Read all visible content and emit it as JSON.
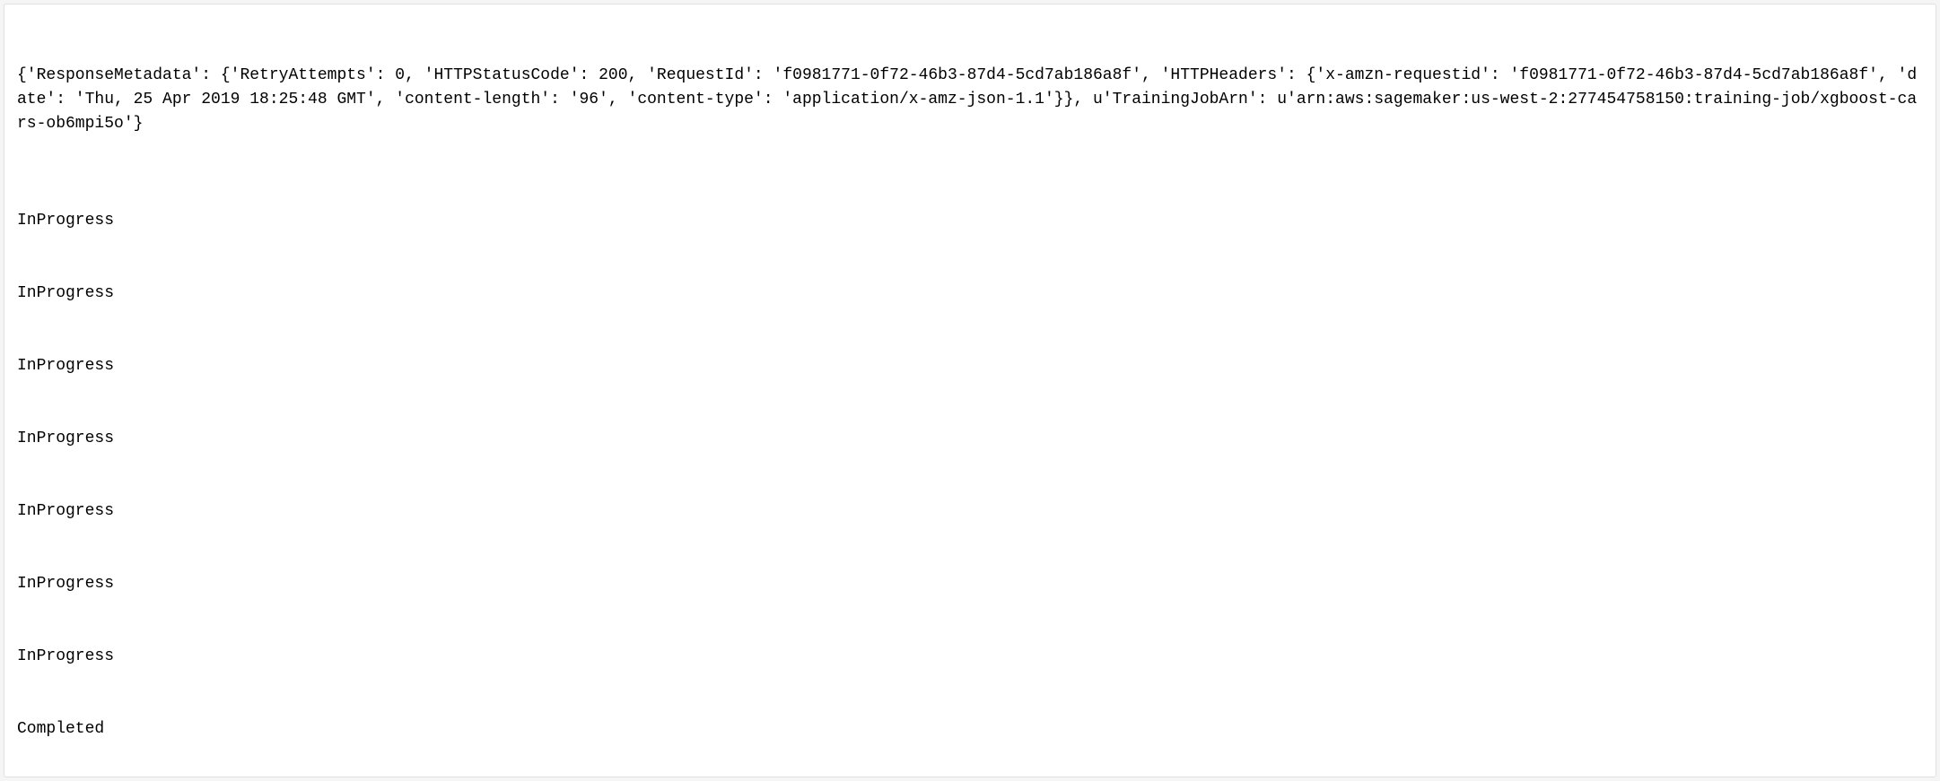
{
  "output": {
    "response_metadata_text": "{'ResponseMetadata': {'RetryAttempts': 0, 'HTTPStatusCode': 200, 'RequestId': 'f0981771-0f72-46b3-87d4-5cd7ab186a8f', 'HTTPHeaders': {'x-amzn-requestid': 'f0981771-0f72-46b3-87d4-5cd7ab186a8f', 'date': 'Thu, 25 Apr 2019 18:25:48 GMT', 'content-length': '96', 'content-type': 'application/x-amz-json-1.1'}}, u'TrainingJobArn': u'arn:aws:sagemaker:us-west-2:277454758150:training-job/xgboost-cars-ob6mpi5o'}",
    "status_lines": [
      "InProgress",
      "InProgress",
      "InProgress",
      "InProgress",
      "InProgress",
      "InProgress",
      "InProgress",
      "Completed"
    ]
  }
}
